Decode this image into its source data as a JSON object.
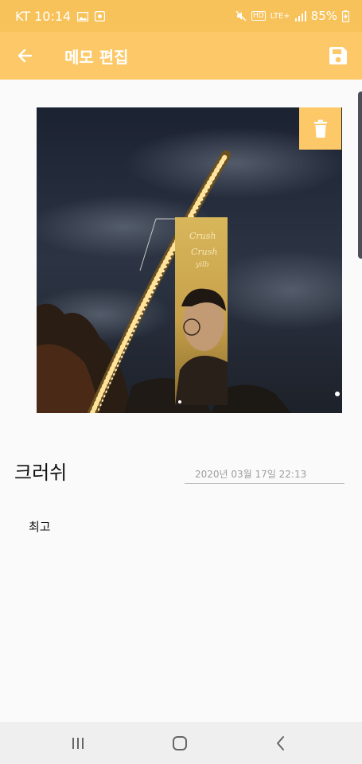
{
  "status": {
    "carrier_time": "KT 10:14",
    "network": "LTE+",
    "battery": "85%"
  },
  "app_bar": {
    "title": "메모 편집",
    "back_icon": "arrow-left-icon",
    "save_icon": "save-floppy-icon",
    "color": "#fdc968"
  },
  "photo": {
    "banner_text": "Crush Crush\nyilb"
  },
  "memo": {
    "title": "크러쉬",
    "date": "2020년 03월 17일 22:13",
    "body": "최고"
  },
  "nav": {
    "recent_icon": "recent-apps-icon",
    "home_icon": "home-icon",
    "back_icon": "back-chevron-icon"
  }
}
